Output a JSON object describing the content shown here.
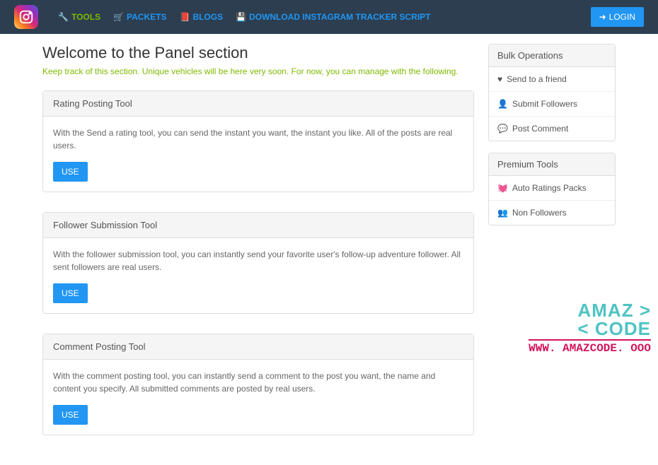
{
  "nav": {
    "tools": "TOOLS",
    "packets": "PACKETS",
    "blogs": "BLOGS",
    "download": "DOWNLOAD INSTAGRAM TRACKER SCRIPT",
    "login": "LOGIN"
  },
  "page": {
    "title": "Welcome to the Panel section",
    "subtitle": "Keep track of this section. Unique vehicles will be here very soon. For now, you can manage with the following."
  },
  "cards": [
    {
      "title": "Rating Posting Tool",
      "desc": "With the Send a rating tool, you can send the instant you want, the instant you like. All of the posts are real users.",
      "btn": "USE"
    },
    {
      "title": "Follower Submission Tool",
      "desc": "With the follower submission tool, you can instantly send your favorite user's follow-up adventure follower. All sent followers are real users.",
      "btn": "USE"
    },
    {
      "title": "Comment Posting Tool",
      "desc": "With the comment posting tool, you can instantly send a comment to the post you want, the name and content you specify. All submitted comments are posted by real users.",
      "btn": "USE"
    }
  ],
  "bulk": {
    "title": "Bulk Operations",
    "items": [
      "Send to a friend",
      "Submit Followers",
      "Post Comment"
    ]
  },
  "premium": {
    "title": "Premium Tools",
    "items": [
      "Auto Ratings Packs",
      "Non Followers"
    ]
  },
  "watermark": {
    "line1": "AMAZ >",
    "line2": "< CODE",
    "url": "WWW. AMAZCODE. OOO"
  }
}
